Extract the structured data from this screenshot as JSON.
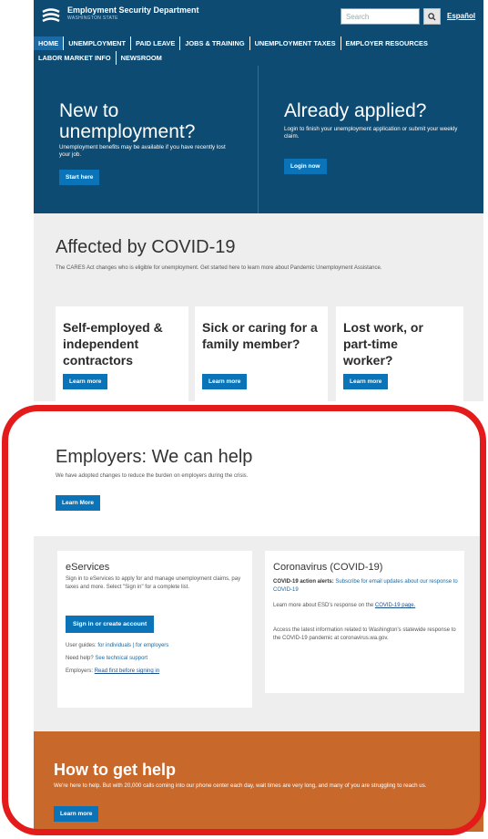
{
  "header": {
    "title": "Employment Security Department",
    "subtitle": "WASHINGTON STATE",
    "search_placeholder": "Search",
    "language_link": "Español",
    "logo_icon": "esd-logo-icon",
    "search_icon": "search-icon"
  },
  "nav": {
    "items": [
      "HOME",
      "UNEMPLOYMENT",
      "PAID LEAVE",
      "JOBS & TRAINING",
      "UNEMPLOYMENT TAXES",
      "EMPLOYER RESOURCES",
      "LABOR MARKET INFO",
      "NEWSROOM"
    ]
  },
  "hero": {
    "left": {
      "title": "New to unemployment?",
      "text": "Unemployment benefits may be available if you have recently lost your job.",
      "button": "Start here"
    },
    "right": {
      "title": "Already applied?",
      "text": "Login to finish your unemployment application or submit your weekly claim.",
      "button": "Login now"
    }
  },
  "covid": {
    "title": "Affected by COVID-19",
    "text": "The CARES Act changes who is eligible for unemployment. Get started here to learn more about Pandemic Unemployment Assistance.",
    "cards": [
      {
        "title": "Self-employed & independent contractors",
        "button": "Learn more"
      },
      {
        "title": "Sick or caring for a family member?",
        "button": "Learn more"
      },
      {
        "title": "Lost work, or part-time worker?",
        "button": "Learn more"
      }
    ]
  },
  "employers": {
    "title": "Employers: We can help",
    "text": "We have adopted changes to reduce the burden on employers during the crisis.",
    "button": "Learn More"
  },
  "eservices": {
    "title": "eServices",
    "text": "Sign in to eServices to apply for and manage unemployment claims, pay taxes and more. Select \"Sign in\" for a complete list.",
    "button": "Sign in or create account",
    "guides_label": "User guides:",
    "guides_individuals": "for individuals",
    "guides_employers": "for employers",
    "help_label": "Need help?",
    "help_link": "See technical support",
    "employers_label": "Employers:",
    "employers_link": "Read first before signing in"
  },
  "coronavirus": {
    "title": "Coronavirus (COVID-19)",
    "alert_label": "COVID-19 action alerts:",
    "alert_link": "Subscribe for email updates about our response to COVID-19",
    "more_text": "Learn more about ESD's response on the",
    "more_link": "COVID-19 page.",
    "latest_text": "Access the latest information related to Washington's statewide response to the COVID-19 pandemic at coronavirus.wa.gov."
  },
  "help": {
    "title": "How to get help",
    "text": "We're here to help. But with 20,000 calls coming into our phone center each day, wait times are very long, and many of you are struggling to reach us.",
    "button": "Learn more"
  },
  "colors": {
    "nav_blue": "#0d4b73",
    "button_blue": "#0b74b8",
    "help_orange": "#c8682a",
    "highlight_red": "#e31b1b"
  }
}
